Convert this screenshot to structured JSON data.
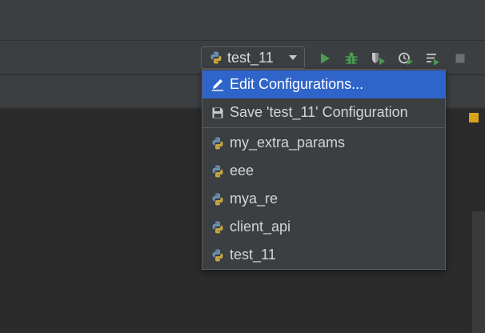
{
  "toolbar": {
    "run_config": {
      "label": "test_11"
    },
    "buttons": [
      {
        "name": "run-icon",
        "color": "#499c54"
      },
      {
        "name": "debug-icon",
        "color": "#499c54"
      },
      {
        "name": "run-with-coverage-icon",
        "color": "#499c54"
      },
      {
        "name": "profile-icon",
        "color": "#499c54"
      },
      {
        "name": "concurrency-diagram-icon",
        "color": "#499c54"
      },
      {
        "name": "stop-icon",
        "color": "#6e6e6e"
      }
    ]
  },
  "menu": {
    "actions": [
      {
        "label": "Edit  Configurations...",
        "icon": "pencil-icon",
        "selected": true
      },
      {
        "label": "Save  'test_11'  Configuration",
        "icon": "save-icon",
        "selected": false
      }
    ],
    "configurations": [
      {
        "label": "my_extra_params",
        "icon": "python-icon"
      },
      {
        "label": "eee",
        "icon": "python-icon"
      },
      {
        "label": "mya_re",
        "icon": "python-icon"
      },
      {
        "label": "client_api",
        "icon": "python-icon"
      },
      {
        "label": "test_11",
        "icon": "python-icon"
      }
    ]
  },
  "colors": {
    "selection": "#2f65ca",
    "background": "#2b2b2b",
    "panel": "#3c3f41",
    "warning_marker": "#d9a21b"
  }
}
